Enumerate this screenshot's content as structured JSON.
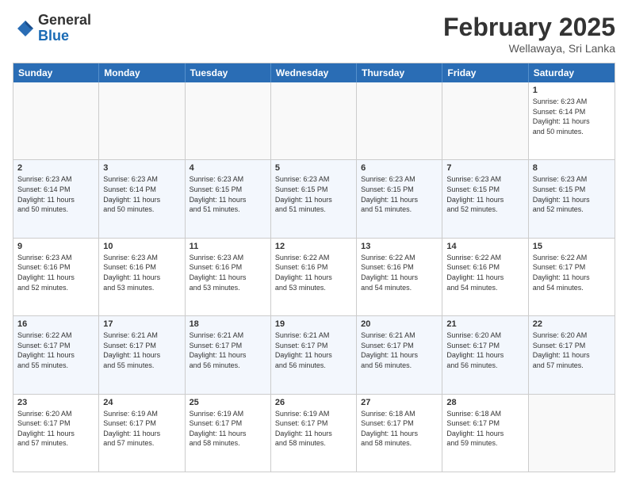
{
  "header": {
    "logo_general": "General",
    "logo_blue": "Blue",
    "month_title": "February 2025",
    "subtitle": "Wellawaya, Sri Lanka"
  },
  "days_of_week": [
    "Sunday",
    "Monday",
    "Tuesday",
    "Wednesday",
    "Thursday",
    "Friday",
    "Saturday"
  ],
  "weeks": [
    [
      {
        "day": "",
        "info": ""
      },
      {
        "day": "",
        "info": ""
      },
      {
        "day": "",
        "info": ""
      },
      {
        "day": "",
        "info": ""
      },
      {
        "day": "",
        "info": ""
      },
      {
        "day": "",
        "info": ""
      },
      {
        "day": "1",
        "info": "Sunrise: 6:23 AM\nSunset: 6:14 PM\nDaylight: 11 hours\nand 50 minutes."
      }
    ],
    [
      {
        "day": "2",
        "info": "Sunrise: 6:23 AM\nSunset: 6:14 PM\nDaylight: 11 hours\nand 50 minutes."
      },
      {
        "day": "3",
        "info": "Sunrise: 6:23 AM\nSunset: 6:14 PM\nDaylight: 11 hours\nand 50 minutes."
      },
      {
        "day": "4",
        "info": "Sunrise: 6:23 AM\nSunset: 6:15 PM\nDaylight: 11 hours\nand 51 minutes."
      },
      {
        "day": "5",
        "info": "Sunrise: 6:23 AM\nSunset: 6:15 PM\nDaylight: 11 hours\nand 51 minutes."
      },
      {
        "day": "6",
        "info": "Sunrise: 6:23 AM\nSunset: 6:15 PM\nDaylight: 11 hours\nand 51 minutes."
      },
      {
        "day": "7",
        "info": "Sunrise: 6:23 AM\nSunset: 6:15 PM\nDaylight: 11 hours\nand 52 minutes."
      },
      {
        "day": "8",
        "info": "Sunrise: 6:23 AM\nSunset: 6:15 PM\nDaylight: 11 hours\nand 52 minutes."
      }
    ],
    [
      {
        "day": "9",
        "info": "Sunrise: 6:23 AM\nSunset: 6:16 PM\nDaylight: 11 hours\nand 52 minutes."
      },
      {
        "day": "10",
        "info": "Sunrise: 6:23 AM\nSunset: 6:16 PM\nDaylight: 11 hours\nand 53 minutes."
      },
      {
        "day": "11",
        "info": "Sunrise: 6:23 AM\nSunset: 6:16 PM\nDaylight: 11 hours\nand 53 minutes."
      },
      {
        "day": "12",
        "info": "Sunrise: 6:22 AM\nSunset: 6:16 PM\nDaylight: 11 hours\nand 53 minutes."
      },
      {
        "day": "13",
        "info": "Sunrise: 6:22 AM\nSunset: 6:16 PM\nDaylight: 11 hours\nand 54 minutes."
      },
      {
        "day": "14",
        "info": "Sunrise: 6:22 AM\nSunset: 6:16 PM\nDaylight: 11 hours\nand 54 minutes."
      },
      {
        "day": "15",
        "info": "Sunrise: 6:22 AM\nSunset: 6:17 PM\nDaylight: 11 hours\nand 54 minutes."
      }
    ],
    [
      {
        "day": "16",
        "info": "Sunrise: 6:22 AM\nSunset: 6:17 PM\nDaylight: 11 hours\nand 55 minutes."
      },
      {
        "day": "17",
        "info": "Sunrise: 6:21 AM\nSunset: 6:17 PM\nDaylight: 11 hours\nand 55 minutes."
      },
      {
        "day": "18",
        "info": "Sunrise: 6:21 AM\nSunset: 6:17 PM\nDaylight: 11 hours\nand 56 minutes."
      },
      {
        "day": "19",
        "info": "Sunrise: 6:21 AM\nSunset: 6:17 PM\nDaylight: 11 hours\nand 56 minutes."
      },
      {
        "day": "20",
        "info": "Sunrise: 6:21 AM\nSunset: 6:17 PM\nDaylight: 11 hours\nand 56 minutes."
      },
      {
        "day": "21",
        "info": "Sunrise: 6:20 AM\nSunset: 6:17 PM\nDaylight: 11 hours\nand 56 minutes."
      },
      {
        "day": "22",
        "info": "Sunrise: 6:20 AM\nSunset: 6:17 PM\nDaylight: 11 hours\nand 57 minutes."
      }
    ],
    [
      {
        "day": "23",
        "info": "Sunrise: 6:20 AM\nSunset: 6:17 PM\nDaylight: 11 hours\nand 57 minutes."
      },
      {
        "day": "24",
        "info": "Sunrise: 6:19 AM\nSunset: 6:17 PM\nDaylight: 11 hours\nand 57 minutes."
      },
      {
        "day": "25",
        "info": "Sunrise: 6:19 AM\nSunset: 6:17 PM\nDaylight: 11 hours\nand 58 minutes."
      },
      {
        "day": "26",
        "info": "Sunrise: 6:19 AM\nSunset: 6:17 PM\nDaylight: 11 hours\nand 58 minutes."
      },
      {
        "day": "27",
        "info": "Sunrise: 6:18 AM\nSunset: 6:17 PM\nDaylight: 11 hours\nand 58 minutes."
      },
      {
        "day": "28",
        "info": "Sunrise: 6:18 AM\nSunset: 6:17 PM\nDaylight: 11 hours\nand 59 minutes."
      },
      {
        "day": "",
        "info": ""
      }
    ]
  ]
}
